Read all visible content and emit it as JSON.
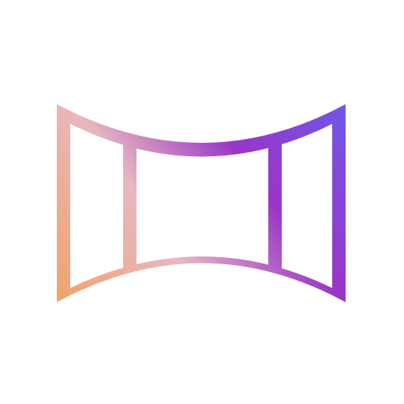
{
  "icon": {
    "name": "panorama-icon",
    "colors": {
      "background": "#ffffff",
      "gradient_violet": "#6f57e8",
      "gradient_purple": "#9a35c8",
      "gradient_pink": "#e7b8c0",
      "gradient_peach": "#f2a26a"
    }
  }
}
